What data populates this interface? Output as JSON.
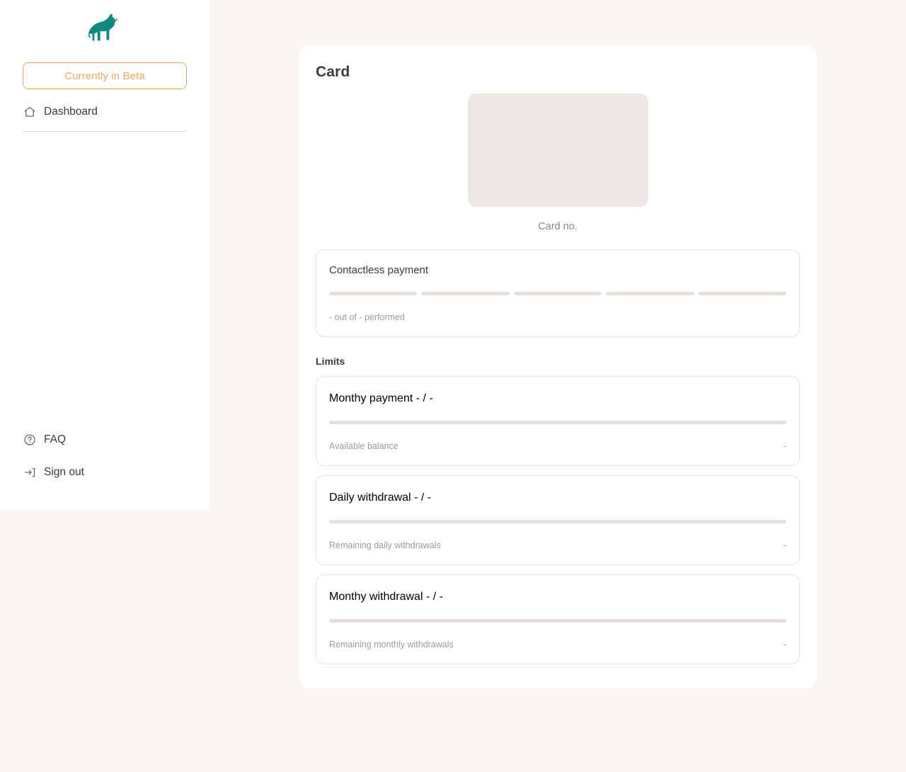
{
  "sidebar": {
    "logo": {
      "icon": "dog-logo-icon",
      "color": "#0f8a7e"
    },
    "beta_badge": {
      "label": "Currently in Beta",
      "color": "#f3a95e"
    },
    "primary_nav": [
      {
        "icon": "home-icon",
        "label": "Dashboard"
      }
    ],
    "bottom_nav": [
      {
        "icon": "question-circle-icon",
        "label": "FAQ"
      },
      {
        "icon": "sign-out-icon",
        "label": "Sign out"
      }
    ]
  },
  "main": {
    "panel_title": "Card",
    "card": {
      "image_placeholder": "card-skeleton",
      "card_no_label": "Card no."
    },
    "contactless": {
      "title": "Contactless payment",
      "segments": 5,
      "segments_filled": 0,
      "note": "- out of - performed"
    },
    "limits_section_title": "Limits",
    "limits": [
      {
        "title": "Monthy payment",
        "value": "- / -",
        "progress": 0,
        "foot_label": "Available balance",
        "foot_value": "-"
      },
      {
        "title": "Daily withdrawal",
        "value": "- / -",
        "progress": 0,
        "foot_label": "Remaining daily withdrawals",
        "foot_value": "-"
      },
      {
        "title": "Monthy withdrawal",
        "value": "- / -",
        "progress": 0,
        "foot_label": "Remaining monthly withdrawals",
        "foot_value": "-"
      }
    ]
  },
  "theme": {
    "page_bg": "#faf5f0",
    "panel_bg": "#ffffff",
    "accent_orange": "#f3a95e",
    "brand_teal": "#0f8a7e",
    "skeleton": "#ece7e3",
    "muted_text": "#9b9b9b"
  }
}
